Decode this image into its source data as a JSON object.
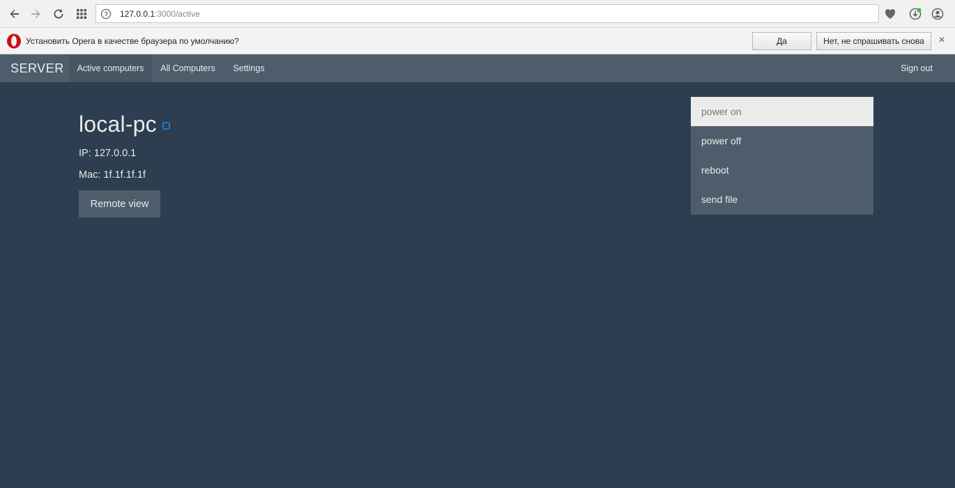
{
  "browser": {
    "url_host": "127.0.0.1",
    "url_path": ":3000/active"
  },
  "infobar": {
    "message": "Установить Opera в качестве браузера по умолчанию?",
    "yes_label": "Да",
    "no_label": "Нет, не спрашивать снова",
    "close_label": "×"
  },
  "navbar": {
    "brand": "SERVER",
    "items": [
      {
        "label": "Active computers",
        "active": true
      },
      {
        "label": "All Computers",
        "active": false
      },
      {
        "label": "Settings",
        "active": false
      }
    ],
    "sign_out": "Sign out"
  },
  "computer": {
    "name": "local-pc",
    "ip": "IP: 127.0.0.1",
    "mac": "Mac: 1f.1f.1f.1f",
    "remote_view_label": "Remote view"
  },
  "actions_menu": {
    "items": [
      "power on",
      "power off",
      "reboot",
      "send file"
    ],
    "highlighted": "power on"
  },
  "colors": {
    "background": "#2c3e50",
    "navbar": "#4e5d6c",
    "status_accent": "#1a7cd0"
  }
}
